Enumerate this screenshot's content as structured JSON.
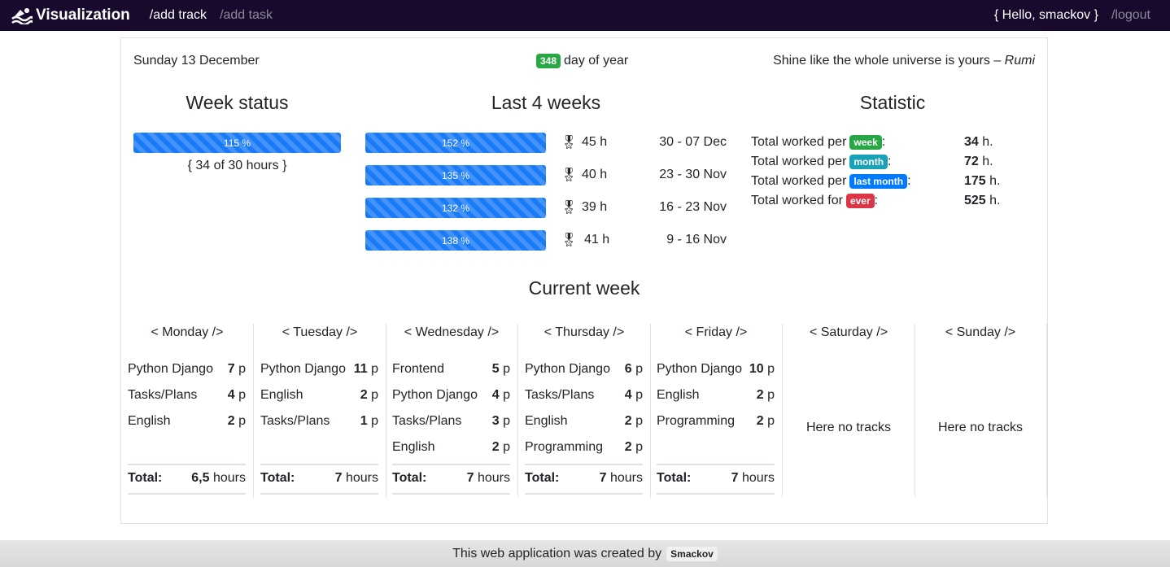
{
  "navbar": {
    "brand": "Visualization",
    "links": [
      {
        "label": "/add track"
      },
      {
        "label": "/add task"
      }
    ],
    "greeting": "{ Hello, smackov }",
    "logout": "/logout"
  },
  "header": {
    "date": "Sunday 13 December",
    "day_of_year": "348",
    "day_of_year_label": "day of year",
    "quote_text": "Shine like the whole universe is yours – ",
    "quote_author": "Rumi"
  },
  "week_status": {
    "title": "Week status",
    "percent_label": "115 %",
    "progress": 1.15,
    "summary": "{ 34 of 30 hours }"
  },
  "last_weeks": {
    "title": "Last 4 weeks",
    "weeks": [
      {
        "percent_label": "152 %",
        "progress": 1.52,
        "medal": "🎖",
        "hours": "45 h",
        "range": "30 - 07 Dec"
      },
      {
        "percent_label": "135 %",
        "progress": 1.35,
        "medal": "🎖",
        "hours": "40 h",
        "range": "23 - 30 Nov"
      },
      {
        "percent_label": "132 %",
        "progress": 1.32,
        "medal": "🎖",
        "hours": "39 h",
        "range": "16 - 23 Nov"
      },
      {
        "percent_label": "138 %",
        "progress": 1.38,
        "medal": "🎖",
        "hours": "41 h",
        "range": "9 - 16 Nov"
      }
    ]
  },
  "statistic": {
    "title": "Statistic",
    "rows": [
      {
        "label": "Total worked per",
        "badge": "week",
        "badge_color": "#28a745",
        "value": "34",
        "unit": " h."
      },
      {
        "label": "Total worked per",
        "badge": "month",
        "badge_color": "#17a2b8",
        "value": "72",
        "unit": " h."
      },
      {
        "label": "Total worked per",
        "badge": "last month",
        "badge_color": "#007bff",
        "value": "175",
        "unit": " h."
      },
      {
        "label": "Total worked for",
        "badge": "ever",
        "badge_color": "#dc3545",
        "value": "525",
        "unit": " h."
      }
    ],
    "colon": ":"
  },
  "current_week": {
    "title": "Current week",
    "total_label": "Total:",
    "hours_unit": " hours",
    "p_unit": " p",
    "days": [
      {
        "name": "< Monday />",
        "tracks": [
          {
            "name": "Python Django",
            "value": "7"
          },
          {
            "name": "Tasks/Plans",
            "value": "4"
          },
          {
            "name": "English",
            "value": "2"
          }
        ],
        "total": "6,5"
      },
      {
        "name": "< Tuesday />",
        "tracks": [
          {
            "name": "Python Django",
            "value": "11"
          },
          {
            "name": "English",
            "value": "2"
          },
          {
            "name": "Tasks/Plans",
            "value": "1"
          }
        ],
        "total": "7"
      },
      {
        "name": "< Wednesday />",
        "tracks": [
          {
            "name": "Frontend",
            "value": "5"
          },
          {
            "name": "Python Django",
            "value": "4"
          },
          {
            "name": "Tasks/Plans",
            "value": "3"
          },
          {
            "name": "English",
            "value": "2"
          }
        ],
        "total": "7"
      },
      {
        "name": "< Thursday />",
        "tracks": [
          {
            "name": "Python Django",
            "value": "6"
          },
          {
            "name": "Tasks/Plans",
            "value": "4"
          },
          {
            "name": "English",
            "value": "2"
          },
          {
            "name": "Programming",
            "value": "2"
          }
        ],
        "total": "7"
      },
      {
        "name": "< Friday />",
        "tracks": [
          {
            "name": "Python Django",
            "value": "10"
          },
          {
            "name": "English",
            "value": "2"
          },
          {
            "name": "Programming",
            "value": "2"
          }
        ],
        "total": "7"
      },
      {
        "name": "< Saturday />",
        "tracks": [],
        "empty_text": "Here no tracks"
      },
      {
        "name": "< Sunday />",
        "tracks": [],
        "empty_text": "Here no tracks"
      }
    ]
  },
  "footer": {
    "text": "This web application was created by",
    "author": "Smackov"
  }
}
